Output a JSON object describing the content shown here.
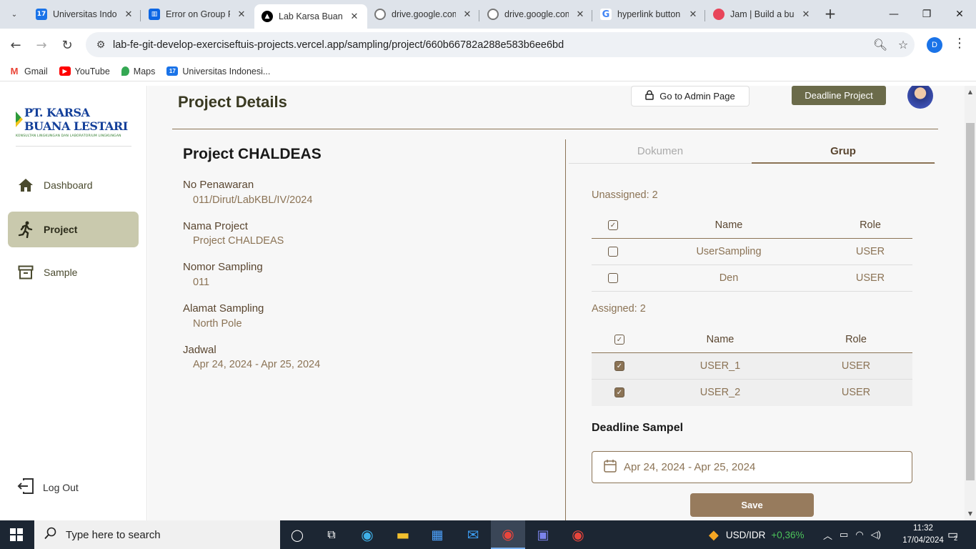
{
  "browser": {
    "tabs": [
      {
        "title": "Universitas Indonesia",
        "icon": "calendar-icon",
        "color": "#1a73e8",
        "badge": "17"
      },
      {
        "title": "Error on Group F",
        "icon": "trello-icon",
        "color": "#0c66e4",
        "badge": ""
      },
      {
        "title": "Lab Karsa Buana",
        "icon": "vercel-icon",
        "color": "#000000",
        "badge": "▲"
      },
      {
        "title": "drive.google.com",
        "icon": "globe-icon",
        "color": "#777777",
        "badge": ""
      },
      {
        "title": "drive.google.com",
        "icon": "globe-icon",
        "color": "#777777",
        "badge": ""
      },
      {
        "title": "hyperlink button",
        "icon": "google-icon",
        "color": "#4285f4",
        "badge": "G"
      },
      {
        "title": "Jam | Build a bug",
        "icon": "jam-icon",
        "color": "#e8455a",
        "badge": ""
      }
    ],
    "url": "lab-fe-git-develop-exerciseftuis-projects.vercel.app/sampling/project/660b66782a288e583b6ee6bd",
    "profile_initial": "D",
    "bookmarks": [
      {
        "label": "Gmail",
        "icon": "gmail-icon",
        "color": "#ea4335",
        "badge": "M"
      },
      {
        "label": "YouTube",
        "icon": "youtube-icon",
        "color": "#ff0000",
        "badge": "▶"
      },
      {
        "label": "Maps",
        "icon": "maps-icon",
        "color": "#34a853",
        "badge": "•"
      },
      {
        "label": "Universitas Indonesi...",
        "icon": "calendar-icon",
        "color": "#1a73e8",
        "badge": "17"
      }
    ]
  },
  "sidebar": {
    "logo_name": "PT. KARSA BUANA LESTARI",
    "logo_tagline": "KONSULTAN LINGKUNGAN DAN LABORATORIUM LINGKUNGAN",
    "items": [
      {
        "label": "Dashboard",
        "icon": "home-icon"
      },
      {
        "label": "Project",
        "icon": "running-person-icon"
      },
      {
        "label": "Sample",
        "icon": "archive-box-icon"
      }
    ],
    "logout_label": "Log Out"
  },
  "header": {
    "title": "Project Details",
    "admin_button": "Go to Admin Page",
    "deadline_button": "Deadline Project"
  },
  "project": {
    "name": "Project CHALDEAS",
    "fields": [
      {
        "label": "No Penawaran",
        "value": "011/Dirut/LabKBL/IV/2024"
      },
      {
        "label": "Nama Project",
        "value": "Project CHALDEAS"
      },
      {
        "label": "Nomor Sampling",
        "value": "011"
      },
      {
        "label": "Alamat Sampling",
        "value": "North Pole"
      },
      {
        "label": "Jadwal",
        "value": "Apr 24, 2024 - Apr 25, 2024"
      }
    ]
  },
  "tabs": {
    "dokumen": "Dokumen",
    "grup": "Grup"
  },
  "unassigned": {
    "label": "Unassigned: 2",
    "col_name": "Name",
    "col_role": "Role",
    "rows": [
      {
        "name": "UserSampling",
        "role": "USER",
        "checked": false
      },
      {
        "name": "Den",
        "role": "USER",
        "checked": false
      }
    ]
  },
  "assigned": {
    "label": "Assigned: 2",
    "col_name": "Name",
    "col_role": "Role",
    "rows": [
      {
        "name": "USER_1",
        "role": "USER",
        "checked": true
      },
      {
        "name": "USER_2",
        "role": "USER",
        "checked": true
      }
    ]
  },
  "deadline": {
    "title": "Deadline Sampel",
    "date_range": "Apr 24, 2024 - Apr 25, 2024",
    "save_label": "Save"
  },
  "taskbar": {
    "search_placeholder": "Type here to search",
    "ticker_pair": "USD/IDR",
    "ticker_change": "+0,36%",
    "time": "11:32",
    "date": "17/04/2024",
    "notification_count": "2"
  },
  "colors": {
    "accent_brown": "#8b7355",
    "olive_button": "#6b6b4a",
    "active_nav_bg": "#c9c9ad",
    "ticker_green": "#4cc25a"
  }
}
